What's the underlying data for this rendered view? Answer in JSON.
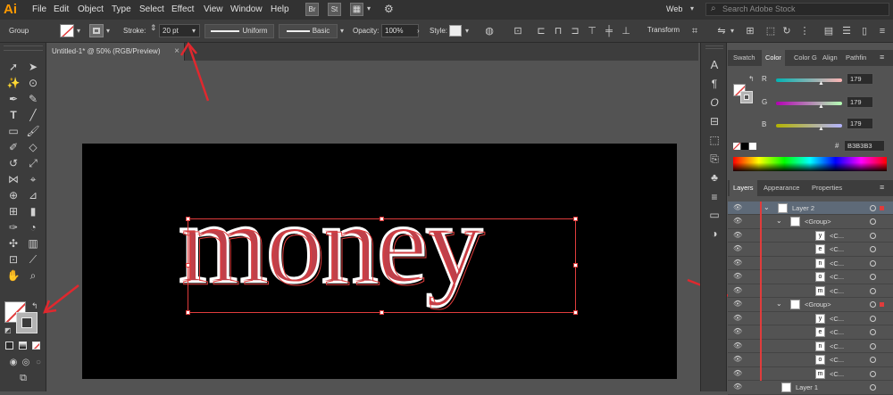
{
  "menubar": {
    "logo": "Ai",
    "items": [
      "File",
      "Edit",
      "Object",
      "Type",
      "Select",
      "Effect",
      "View",
      "Window",
      "Help"
    ],
    "bridge": "Br",
    "stock": "St",
    "workspace": "Web",
    "search_placeholder": "Search Adobe Stock"
  },
  "controlbar": {
    "selection": "Group",
    "stroke_label": "Stroke:",
    "stroke_value": "20 pt",
    "profile": "Uniform",
    "brush": "Basic",
    "opacity_label": "Opacity:",
    "opacity_value": "100%",
    "style_label": "Style:",
    "transform": "Transform"
  },
  "document": {
    "tab_title": "Untitled-1* @ 50% (RGB/Preview)",
    "artwork_text": "money"
  },
  "color_panel": {
    "tabs": [
      "Swatch",
      "Color",
      "Color G",
      "Align",
      "Pathfin"
    ],
    "active_tab": "Color",
    "r_label": "R",
    "r_value": "179",
    "g_label": "G",
    "g_value": "179",
    "b_label": "B",
    "b_value": "179",
    "hex_label": "#",
    "hex_value": "B3B3B3"
  },
  "layers_panel": {
    "tabs": [
      "Layers",
      "Appearance",
      "Properties"
    ],
    "active_tab": "Layers",
    "rows": [
      {
        "name": "Layer 2",
        "glyph": ""
      },
      {
        "name": "<Group>",
        "glyph": ""
      },
      {
        "name": "<C...",
        "glyph": "y"
      },
      {
        "name": "<C...",
        "glyph": "e"
      },
      {
        "name": "<C...",
        "glyph": "n"
      },
      {
        "name": "<C...",
        "glyph": "o"
      },
      {
        "name": "<C...",
        "glyph": "m"
      },
      {
        "name": "<Group>",
        "glyph": ""
      },
      {
        "name": "<C...",
        "glyph": "y"
      },
      {
        "name": "<C...",
        "glyph": "e"
      },
      {
        "name": "<C...",
        "glyph": "n"
      },
      {
        "name": "<C...",
        "glyph": "o"
      },
      {
        "name": "<C...",
        "glyph": "m"
      },
      {
        "name": "Layer 1",
        "glyph": ""
      }
    ]
  },
  "colors": {
    "accent_red": "#e0282e",
    "selection_red": "#e03c3c",
    "fill_gray": "#B3B3B3"
  }
}
